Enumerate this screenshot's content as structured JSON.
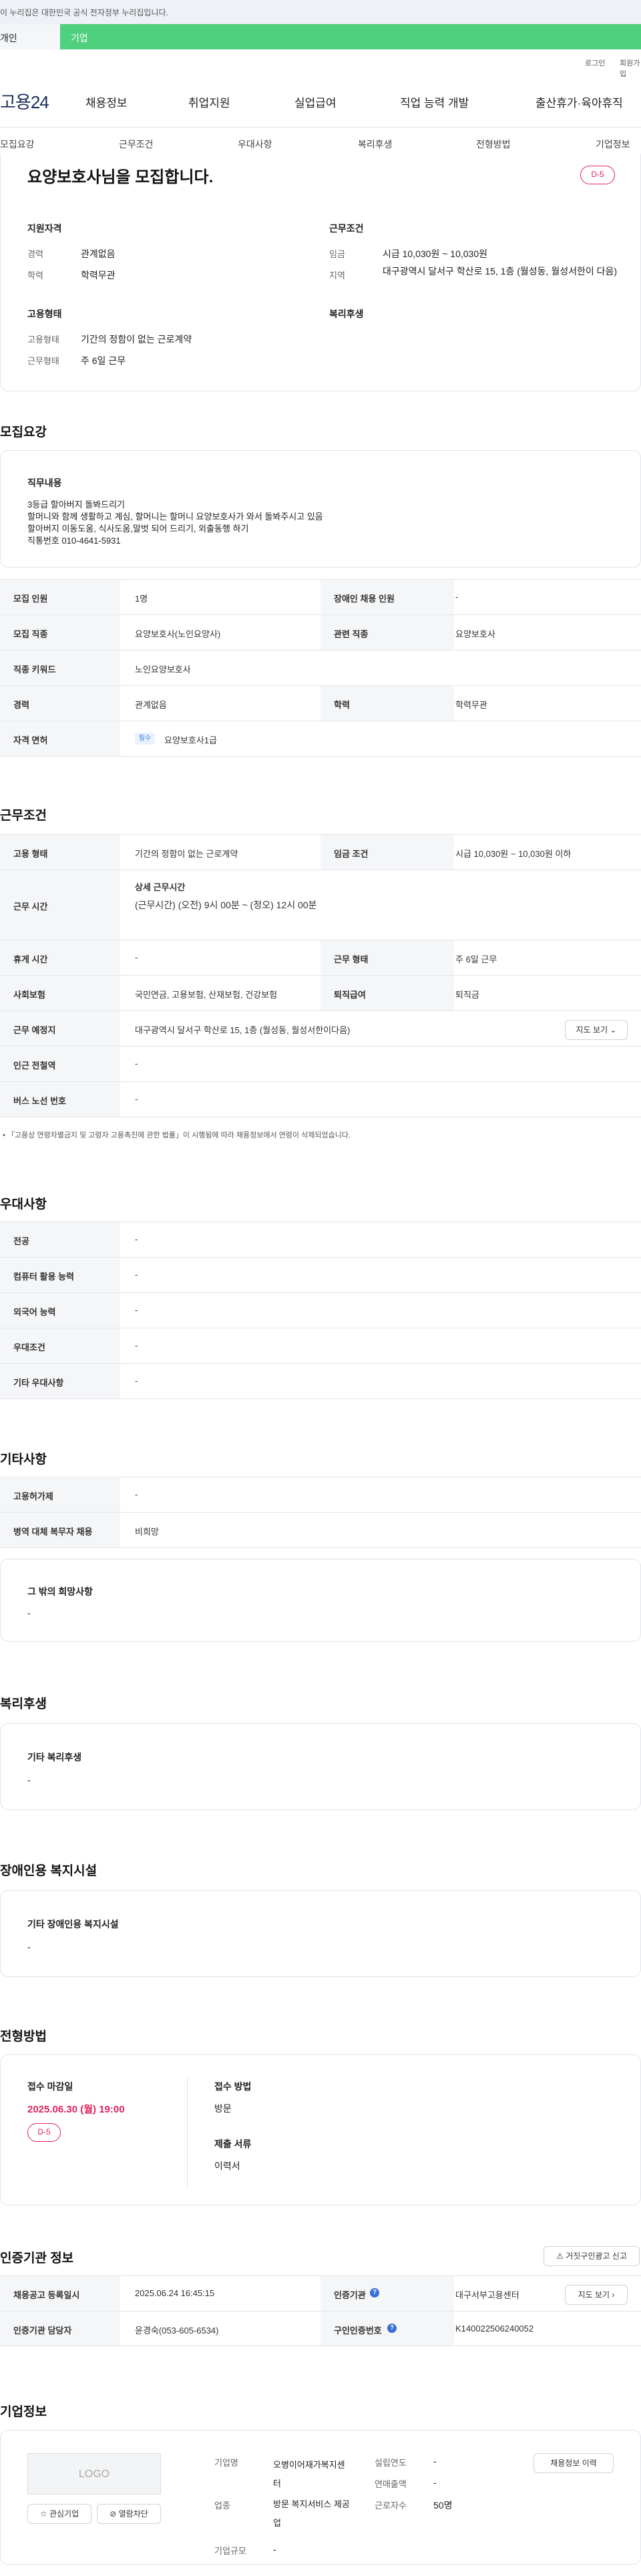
{
  "gov_banner": "이 누리집은 대한민국 공식 전자정부 누리집입니다.",
  "tabs": {
    "individual": "개인",
    "corporate": "기업"
  },
  "util": {
    "login": "로그인",
    "signup": "회원가입"
  },
  "brand": "고용24",
  "gnb": [
    "채용정보",
    "취업지원",
    "실업급여",
    "직업 능력 개발",
    "출산휴가·육아휴직"
  ],
  "subnav": [
    "모집요강",
    "근무조건",
    "우대사항",
    "복리후생",
    "전형방법",
    "기업정보"
  ],
  "job": {
    "title": "요양보호사님을 모집합니다.",
    "dday": "D-5"
  },
  "summary": {
    "qual_title": "지원자격",
    "qual": [
      {
        "label": "경력",
        "value": "관계없음"
      },
      {
        "label": "학력",
        "value": "학력무관"
      }
    ],
    "cond_title": "근무조건",
    "cond": [
      {
        "label": "임금",
        "value": "시급 10,030원 ~ 10,030원"
      },
      {
        "label": "지역",
        "value": "대구광역시 달서구 학산로 15, 1층 (월성동, 월성서한이 다음)"
      }
    ],
    "emp_title": "고용형태",
    "emp": [
      {
        "label": "고용형태",
        "value": "기간의 정함이 없는 근로계약"
      },
      {
        "label": "근무형태",
        "value": "주 6일 근무"
      }
    ],
    "welfare_title": "복리후생"
  },
  "recruit": {
    "heading": "모집요강",
    "duty_title": "직무내용",
    "duty_lines": [
      "3등급 할아버지 돌봐드리기",
      "할머니와 함께 생활하고 계심, 할머니는 할머니 요양보호사가 와서 돌봐주시고 있음",
      "할아버지 이동도움, 식사도움,말벗 되어 드리기, 외출동행 하기",
      "직통번호 010-4641-5931"
    ],
    "rows": [
      {
        "l1": "모집 인원",
        "v1": "1명",
        "l2": "장애인 채용 인원",
        "v2": "-"
      },
      {
        "l1": "모집 직종",
        "v1": "요양보호사(노인요양사)",
        "l2": "관련 직종",
        "v2": "요양보호사"
      },
      {
        "l1": "직종 키워드",
        "v1": "노인요양보호사"
      },
      {
        "l1": "경력",
        "v1": "관계없음",
        "l2": "학력",
        "v2": "학력무관"
      },
      {
        "l1": "자격 면허",
        "badge": "필수",
        "v1": "요양보호사1급"
      }
    ]
  },
  "work": {
    "heading": "근무조건",
    "emp_type_l": "고용 형태",
    "emp_type_v": "기간의 정함이 없는 근로계약",
    "wage_l": "임금 조건",
    "wage_v": "시급 10,030원 ~ 10,030원 이하",
    "hours_l": "근무 시간",
    "hours_title": "상세 근무시간",
    "hours_v": "(근무시간) (오전) 9시 00분 ~ (정오) 12시 00분",
    "rest_l": "휴게 시간",
    "rest_v": "-",
    "form_l": "근무 형태",
    "form_v": "주 6일 근무",
    "ins_l": "사회보험",
    "ins_v": "국민연금, 고용보험, 산재보험, 건강보험",
    "ret_l": "퇴직급여",
    "ret_v": "퇴직금",
    "place_l": "근무 예정지",
    "place_v": "대구광역시 달서구 학산로 15, 1층 (월성동, 월성서한이다음)",
    "map_btn": "지도 보기",
    "subway_l": "인근 전철역",
    "subway_v": "-",
    "bus_l": "버스 노선 번호",
    "bus_v": "-",
    "note": "「고용상 연령차별금지 및 고령자 고용촉진에 관한 법률」이 시행됨에 따라 채용정보에서 연령이 삭제되었습니다."
  },
  "pref": {
    "heading": "우대사항",
    "rows": [
      {
        "l": "전공",
        "v": "-"
      },
      {
        "l": "컴퓨터 활용 능력",
        "v": "-"
      },
      {
        "l": "외국어 능력",
        "v": "-"
      },
      {
        "l": "우대조건",
        "v": "-"
      },
      {
        "l": "기타 우대사항",
        "v": "-"
      }
    ]
  },
  "etc": {
    "heading": "기타사항",
    "rows": [
      {
        "l": "고용허가제",
        "v": "-"
      },
      {
        "l": "병역 대체 복무자 채용",
        "v": "비희망"
      }
    ],
    "other_title": "그 밖의 희망사항",
    "other_v": "-"
  },
  "welfare": {
    "heading": "복리후생",
    "title": "기타 복리후생",
    "v": "-"
  },
  "disabled": {
    "heading": "장애인용 복지시설",
    "title": "기타 장애인용 복지시설",
    "v": "-"
  },
  "selection": {
    "heading": "전형방법",
    "deadline_l": "접수 마감일",
    "deadline_v": "2025.06.30 (월) 19:00",
    "dday": "D-5",
    "method_l": "접수 방법",
    "method_v": "방문",
    "docs_l": "제출 서류",
    "docs_v": "이력서"
  },
  "cert": {
    "heading": "인증기관 정보",
    "report_btn": "거짓구인광고 신고",
    "reg_l": "채용공고 등록일시",
    "reg_v": "2025.06.24 16:45:15",
    "org_l": "인증기관",
    "org_v": "대구서부고용센터",
    "map_btn": "지도 보기",
    "mgr_l": "인증기관 담당자",
    "mgr_v": "윤경숙(053-605-6534)",
    "no_l": "구인인증번호",
    "no_v": "K140022506240052"
  },
  "company": {
    "heading": "기업정보",
    "logo": "LOGO",
    "interest_btn": "관심기업",
    "block_btn": "열람차단",
    "name_l": "기업명",
    "name_v": "오병이어재가복지센터",
    "industry_l": "업종",
    "industry_v": "방문 복지서비스 제공업",
    "size_l": "기업규모",
    "size_v": "-",
    "founded_l": "설립연도",
    "founded_v": "-",
    "revenue_l": "연매출액",
    "revenue_v": "-",
    "staff_l": "근로자수",
    "staff_v": "50명",
    "history_btn": "채용정보 이력"
  }
}
